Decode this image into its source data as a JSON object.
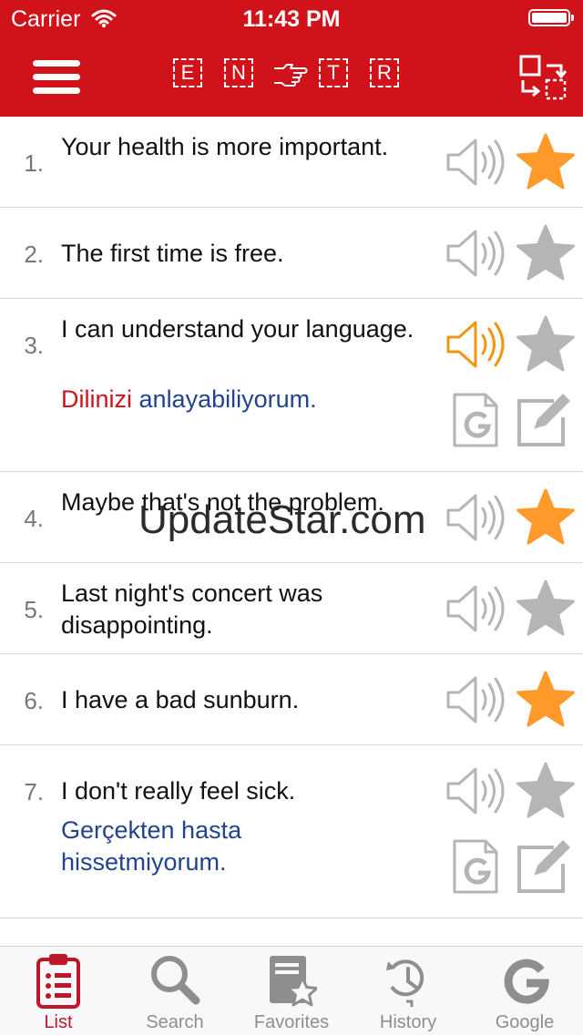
{
  "status_bar": {
    "carrier": "Carrier",
    "time": "11:43 PM"
  },
  "header": {
    "source_letters": [
      "E",
      "N"
    ],
    "target_letters": [
      "T",
      "R"
    ],
    "menu_icon": "hamburger-icon",
    "direction_icon": "pointing-hand-icon",
    "swap_icon": "swap-languages-icon",
    "bar_color": "#d0121b"
  },
  "phrases": [
    {
      "number": "1.",
      "text": "Your health is more important.",
      "favorite": true,
      "playing": false
    },
    {
      "number": "2.",
      "text": "The first time is free.",
      "favorite": false,
      "playing": false
    },
    {
      "number": "3.",
      "text": "I can understand your language.",
      "favorite": false,
      "playing": true,
      "translation_highlight": "Dilinizi",
      "translation_rest": "anlayabiliyorum."
    },
    {
      "number": "4.",
      "text": "Maybe that's not the problem.",
      "favorite": true,
      "playing": false
    },
    {
      "number": "5.",
      "text": "Last night's concert was disappointing.",
      "favorite": false,
      "playing": false
    },
    {
      "number": "6.",
      "text": "I have a bad sunburn.",
      "favorite": true,
      "playing": false
    },
    {
      "number": "7.",
      "text": "I don't really feel sick.",
      "favorite": false,
      "playing": false,
      "translation_highlight": "",
      "translation_rest": "Gerçekten hasta hissetmiyorum."
    }
  ],
  "watermark": "UpdateStar.com",
  "colors": {
    "favorite_star": "#ff9a2a",
    "inactive_icon": "#b5b5b5",
    "active_speaker": "#f0960f",
    "translation_blue": "#22448f",
    "translation_red": "#d0121b",
    "active_tab": "#c0142a"
  },
  "tabs": [
    {
      "label": "List",
      "icon": "clipboard-list-icon",
      "active": true
    },
    {
      "label": "Search",
      "icon": "magnifier-icon",
      "active": false
    },
    {
      "label": "Favorites",
      "icon": "favorites-book-icon",
      "active": false
    },
    {
      "label": "History",
      "icon": "history-clock-icon",
      "active": false
    },
    {
      "label": "Google",
      "icon": "google-g-icon",
      "active": false
    }
  ]
}
